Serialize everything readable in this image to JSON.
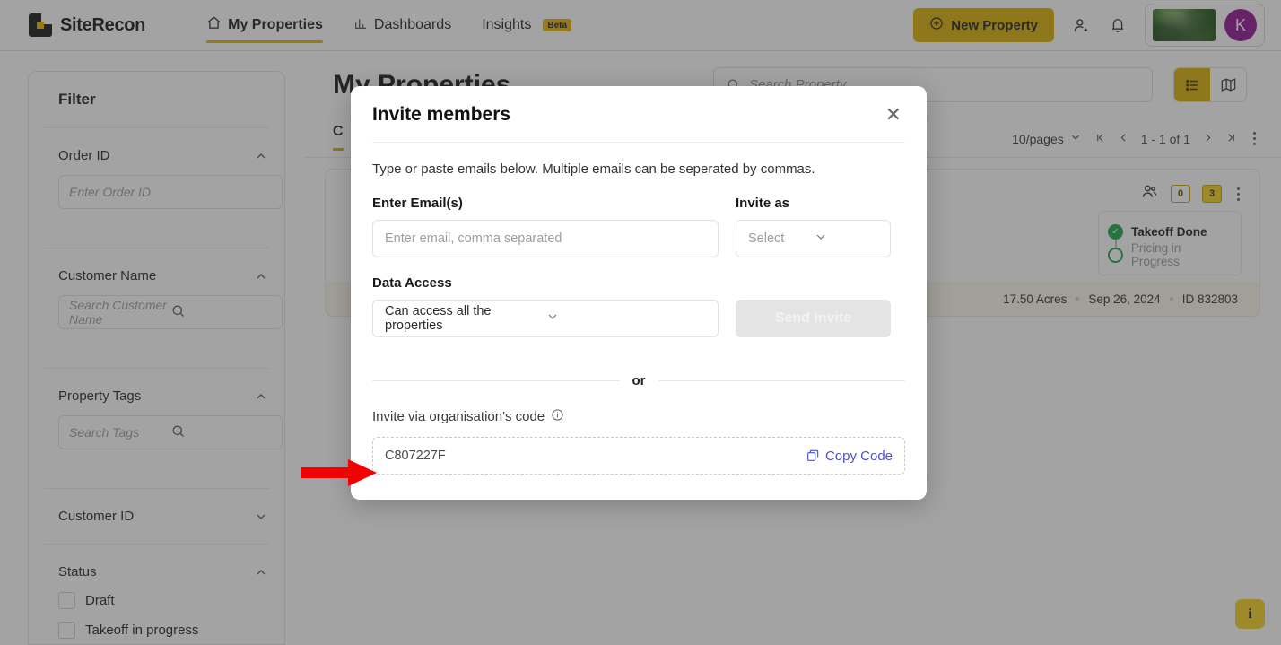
{
  "header": {
    "brand": "SiteRecon",
    "nav": [
      {
        "label": "My Properties",
        "icon": "home-icon",
        "active": true
      },
      {
        "label": "Dashboards",
        "icon": "chart-icon",
        "active": false
      },
      {
        "label": "Insights",
        "icon": "",
        "badge": "Beta",
        "active": false
      }
    ],
    "new_property_label": "New Property",
    "avatar_initial": "K",
    "icons": [
      "add-user-icon",
      "bell-icon"
    ]
  },
  "filter": {
    "title": "Filter",
    "sections": [
      {
        "label": "Order ID",
        "expanded": true,
        "placeholder": "Enter Order ID",
        "search": false
      },
      {
        "label": "Customer Name",
        "expanded": true,
        "placeholder": "Search Customer Name",
        "search": true
      },
      {
        "label": "Property Tags",
        "expanded": true,
        "placeholder": "Search Tags",
        "search": true
      },
      {
        "label": "Customer ID",
        "expanded": false
      },
      {
        "label": "Status",
        "expanded": true
      }
    ],
    "status_options": [
      "Draft",
      "Takeoff in progress"
    ]
  },
  "main": {
    "page_title": "My Properties",
    "search_placeholder": "Search Property",
    "tab_label": "C",
    "pagination": {
      "per_page": "10/pages",
      "range": "1 - 1 of 1"
    },
    "card": {
      "badge_outline": "0",
      "badge_filled": "3",
      "status_done": "Takeoff Done",
      "status_pending": "Pricing in Progress",
      "acres": "17.50 Acres",
      "date": "Sep 26, 2024",
      "id": "ID 832803"
    },
    "info_fab": "i"
  },
  "modal": {
    "title": "Invite members",
    "subtitle": "Type or paste emails below. Multiple emails can be seperated by commas.",
    "email_label": "Enter Email(s)",
    "email_placeholder": "Enter email, comma separated",
    "invite_as_label": "Invite as",
    "invite_as_value": "Select",
    "data_access_label": "Data Access",
    "data_access_value": "Can access all the properties",
    "send_label": "Send Invite",
    "or": "or",
    "org_code_label": "Invite via organisation's code",
    "org_code": "C807227F",
    "copy_label": "Copy Code"
  },
  "colors": {
    "brand_yellow": "#d9ac00",
    "accent_yellow": "#e2b203",
    "link_blue": "#4b4fd1",
    "status_green": "#17a349",
    "avatar_purple": "#8e0e8e",
    "annotation_red": "#f50000"
  }
}
